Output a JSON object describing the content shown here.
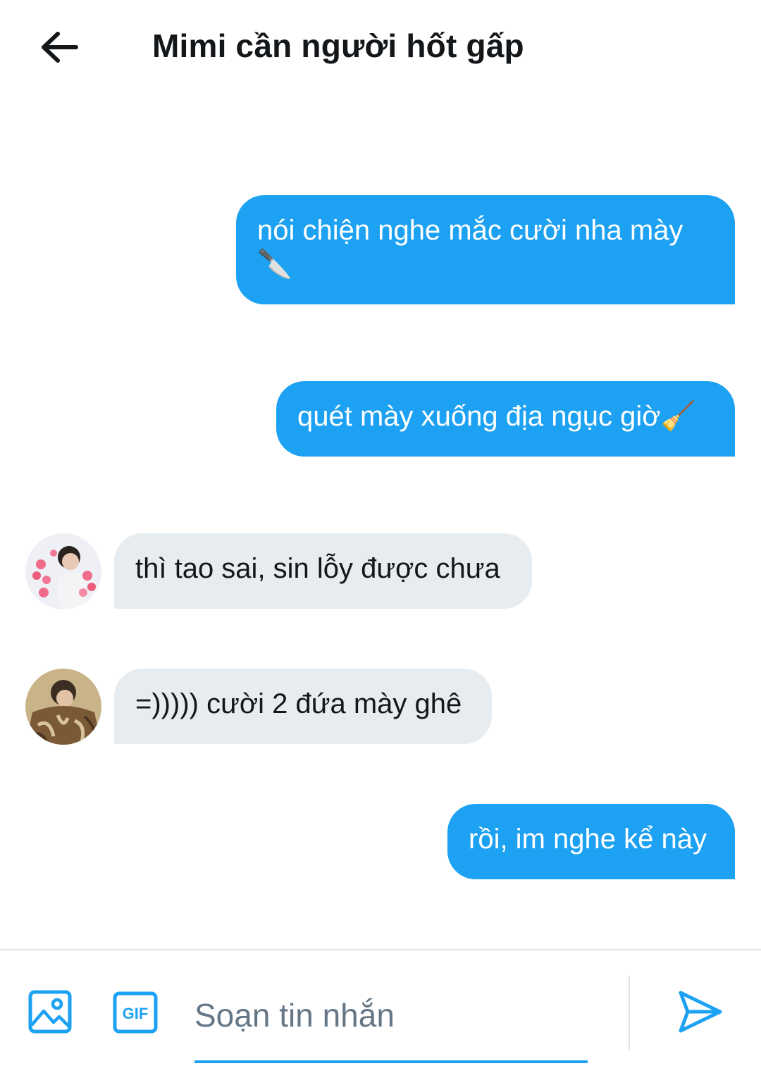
{
  "header": {
    "title": "Mimi cần người hốt gấp",
    "back_icon": "arrow-left-icon"
  },
  "messages": [
    {
      "direction": "outgoing",
      "text": "nói chiện nghe mắc cười nha mày",
      "emoji": "🔪"
    },
    {
      "direction": "outgoing",
      "text": "quét mày xuống địa ngục giờ",
      "emoji": "🧹"
    },
    {
      "direction": "incoming",
      "text": "thì tao sai, sin lỗy được chưa",
      "avatar": "avatar-1"
    },
    {
      "direction": "incoming",
      "text": "=))))) cười 2 đứa mày ghê",
      "avatar": "avatar-2"
    },
    {
      "direction": "outgoing",
      "text": "rồi, im nghe kể này"
    }
  ],
  "composer": {
    "placeholder": "Soạn tin nhắn",
    "gif_label": "GIF",
    "image_icon": "image-icon",
    "send_icon": "send-icon"
  },
  "colors": {
    "accent": "#1da1f2",
    "incoming_bubble": "#e6ecf0",
    "text": "#14171a",
    "placeholder": "#657786"
  }
}
